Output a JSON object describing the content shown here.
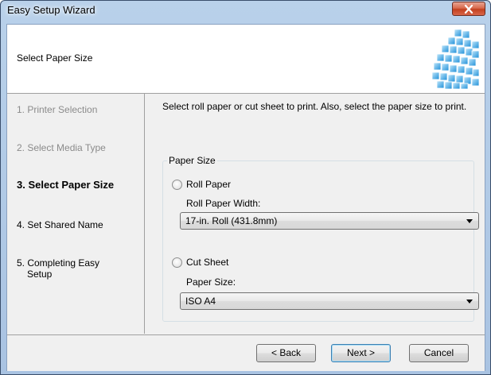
{
  "window": {
    "title": "Easy Setup Wizard"
  },
  "header": {
    "title": "Select Paper Size"
  },
  "steps": [
    {
      "label": "1.  Printer Selection",
      "state": "done"
    },
    {
      "label": "2.  Select Media Type",
      "state": "done"
    },
    {
      "label": "3.  Select Paper Size",
      "state": "active"
    },
    {
      "label": "4.  Set Shared Name",
      "state": "todo"
    },
    {
      "label": "5.  Completing Easy",
      "label2": "Setup",
      "state": "todo"
    }
  ],
  "content": {
    "instructions": "Select roll paper or cut sheet to print. Also, select the paper size to print.",
    "group_label": "Paper Size",
    "roll": {
      "radio_label": "Roll Paper",
      "field_label": "Roll Paper Width:",
      "selected": "17-in. Roll (431.8mm)"
    },
    "cut": {
      "radio_label": "Cut Sheet",
      "field_label": "Paper Size:",
      "selected": "ISO A4"
    }
  },
  "buttons": {
    "back": "< Back",
    "next": "Next >",
    "cancel": "Cancel"
  },
  "colors": {
    "titlebar": "#b9d1ea",
    "close": "#c2401f",
    "panel": "#f0f0f0",
    "disabled_text": "#8b8b8b"
  },
  "icons": [
    "close-icon",
    "wizard-graphic",
    "radio-unchecked-icon",
    "dropdown-arrow-icon"
  ]
}
